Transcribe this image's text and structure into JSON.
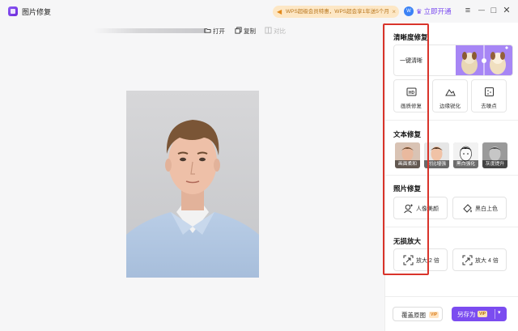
{
  "app": {
    "title": "图片修复"
  },
  "promo": {
    "icon": "megaphone-icon",
    "text": "WPS超级会员特惠，WPS超会享1年送5个月",
    "close": "×"
  },
  "account": {
    "avatar_text": "W",
    "vip_link": "立即开通",
    "crown_icon": "crown-icon"
  },
  "window": {
    "menu": "≡",
    "minimize": "—",
    "maximize": "□",
    "close": "✕"
  },
  "toolbar": {
    "open": "打开",
    "copy": "复制",
    "compare": "对比"
  },
  "panel": {
    "clarity": {
      "title": "清晰度修复",
      "one_click": "一键清晰",
      "tools": [
        {
          "label": "画质修复",
          "icon": "hd-icon"
        },
        {
          "label": "边缘锐化",
          "icon": "mountain-icon"
        },
        {
          "label": "去噪点",
          "icon": "denoise-icon"
        }
      ]
    },
    "text": {
      "title": "文本修复",
      "faces": [
        {
          "label": "画面柔和"
        },
        {
          "label": "对比增强"
        },
        {
          "label": "黑白强化"
        },
        {
          "label": "灰度提升"
        }
      ]
    },
    "photo": {
      "title": "照片修复",
      "buttons": [
        {
          "label": "人像美颜",
          "icon": "portrait-icon"
        },
        {
          "label": "黑白上色",
          "icon": "paint-bucket-icon"
        }
      ]
    },
    "zoom": {
      "title": "无损放大",
      "buttons": [
        {
          "label": "放大 2 倍",
          "icon": "expand-icon"
        },
        {
          "label": "放大 4 倍",
          "icon": "expand-icon"
        }
      ]
    }
  },
  "footer": {
    "cover_original": "覆盖原图",
    "save_as": "另存为",
    "vip_badge": "VIP"
  },
  "colors": {
    "accent": "#7b4cf0",
    "highlight": "#d9342b",
    "promo_bg": "#fde7c5"
  }
}
